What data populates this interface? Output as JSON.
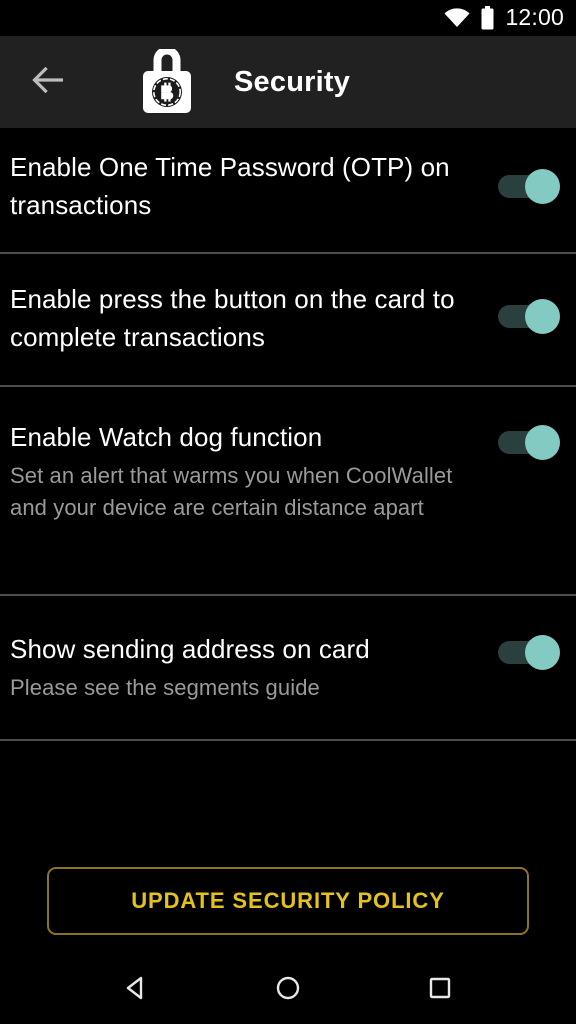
{
  "status_bar": {
    "wifi_icon": "wifi-icon",
    "battery_icon": "battery-full-icon",
    "time": "12:00"
  },
  "app_bar": {
    "back_icon": "back-arrow-icon",
    "brand_icon": "padlock-bitcoin-icon",
    "title": "Security",
    "background_color": "#212121"
  },
  "settings": [
    {
      "title": "Enable One Time Password (OTP) on transactions",
      "subtitle": "",
      "toggle_on": true
    },
    {
      "title": "Enable press the button on the card to complete transactions",
      "subtitle": "",
      "toggle_on": true
    },
    {
      "title": "Enable Watch dog function",
      "subtitle": "Set an alert that warms you when CoolWallet and your device are certain distance apart",
      "toggle_on": true
    },
    {
      "title": "Show sending address on card",
      "subtitle": "Please see the segments guide",
      "toggle_on": true
    }
  ],
  "primary_action": {
    "label": "UPDATE SECURITY POLICY",
    "text_color": "#e4c21c",
    "border_color": "#8a7420"
  },
  "nav_bar": {
    "back": "nav-back-icon",
    "home": "nav-home-icon",
    "recents": "nav-recents-icon"
  },
  "theme": {
    "background": "#000000",
    "switch_track": "#2a403e",
    "switch_thumb": "#82cac2",
    "divider": "#4e4e4e",
    "subtitle_text": "#9a9a9a"
  }
}
